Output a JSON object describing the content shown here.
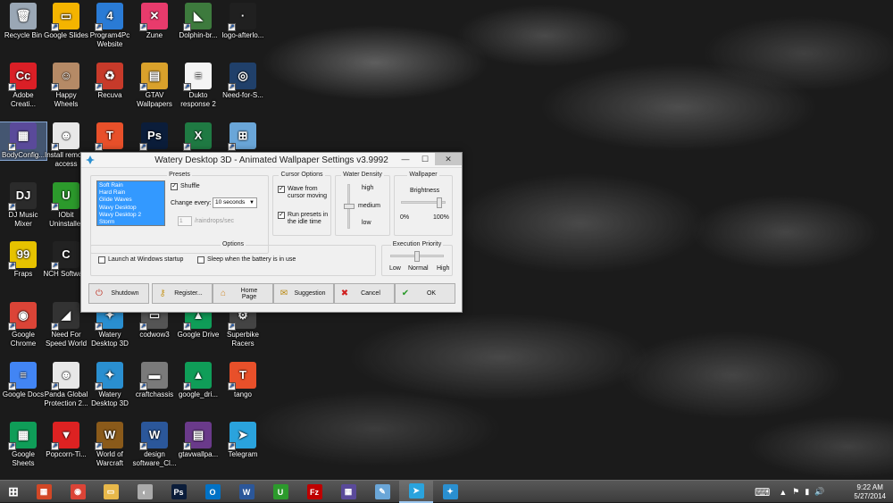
{
  "desktop_icons": [
    {
      "id": "recycle-bin",
      "label": "Recycle Bin",
      "color": "#9aa7b5",
      "glyph": "🗑"
    },
    {
      "id": "google-slides",
      "label": "Google Slides",
      "color": "#f4b400",
      "glyph": "▭"
    },
    {
      "id": "program4pc",
      "label": "Program4Pc Website",
      "color": "#2a7bd5",
      "glyph": "4"
    },
    {
      "id": "zune",
      "label": "Zune",
      "color": "#e83b6c",
      "glyph": "✕"
    },
    {
      "id": "dolphin",
      "label": "Dolphin-br...",
      "color": "#3d7a3d",
      "glyph": "◣"
    },
    {
      "id": "logo-afterlo",
      "label": "logo-afterlo...",
      "color": "#202020",
      "glyph": "·"
    },
    {
      "id": "adobe-creative",
      "label": "Adobe Creati...",
      "color": "#da1f26",
      "glyph": "Cc"
    },
    {
      "id": "happy-wheels",
      "label": "Happy Wheels",
      "color": "#b58a66",
      "glyph": "☺"
    },
    {
      "id": "recuva",
      "label": "Recuva",
      "color": "#c73a2a",
      "glyph": "♻"
    },
    {
      "id": "gtav-wallpapers",
      "label": "GTAV Wallpapers",
      "color": "#d9a12b",
      "glyph": "▤"
    },
    {
      "id": "dukto",
      "label": "Dukto response 2",
      "color": "#f4f4f4",
      "glyph": "≡"
    },
    {
      "id": "need-for-speed-1",
      "label": "Need-for-S...",
      "color": "#20406a",
      "glyph": "◎"
    },
    {
      "id": "bodyconfig",
      "label": "BodyConfig...",
      "color": "#5a4a9a",
      "glyph": "▦"
    },
    {
      "id": "install-remove",
      "label": "Install remo... access",
      "color": "#e8e8e8",
      "glyph": "☻"
    },
    {
      "id": "typora",
      "label": "",
      "color": "#e8502a",
      "glyph": "T"
    },
    {
      "id": "photoshop",
      "label": "",
      "color": "#0b1d3a",
      "glyph": "Ps"
    },
    {
      "id": "excel",
      "label": "",
      "color": "#1f7a43",
      "glyph": "X"
    },
    {
      "id": "windows-tile",
      "label": "",
      "color": "#6aa6d8",
      "glyph": "⊞"
    },
    {
      "id": "dj-music-mixer",
      "label": "DJ Music Mixer",
      "color": "#2b2b2b",
      "glyph": "DJ"
    },
    {
      "id": "iobit",
      "label": "IObit Uninstaller",
      "color": "#2c9a2c",
      "glyph": "U"
    },
    {
      "id": "fraps",
      "label": "Fraps",
      "color": "#e6c200",
      "glyph": "99"
    },
    {
      "id": "nch",
      "label": "NCH Software",
      "color": "#222",
      "glyph": "C"
    },
    {
      "id": "google-chrome",
      "label": "Google Chrome",
      "color": "#db4437",
      "glyph": "◉"
    },
    {
      "id": "nfs-world",
      "label": "Need For Speed World",
      "color": "#333",
      "glyph": "◢"
    },
    {
      "id": "watery-1",
      "label": "Watery Desktop 3D",
      "color": "#2a8fd0",
      "glyph": "✦"
    },
    {
      "id": "codwow3",
      "label": "codwow3",
      "color": "#555",
      "glyph": "▭"
    },
    {
      "id": "google-drive-1",
      "label": "Google Drive",
      "color": "#0f9d58",
      "glyph": "▲"
    },
    {
      "id": "superbike",
      "label": "Superbike Racers",
      "color": "#444",
      "glyph": "⚙"
    },
    {
      "id": "google-docs",
      "label": "Google Docs",
      "color": "#4285f4",
      "glyph": "≡"
    },
    {
      "id": "panda",
      "label": "Panda Global Protection 2...",
      "color": "#e8e8e8",
      "glyph": "☻"
    },
    {
      "id": "watery-2",
      "label": "Watery Desktop 3D",
      "color": "#2a8fd0",
      "glyph": "✦"
    },
    {
      "id": "craftchassis",
      "label": "craftchassis",
      "color": "#7a7a7a",
      "glyph": "▬"
    },
    {
      "id": "google-drive-2",
      "label": "google_dri...",
      "color": "#0f9d58",
      "glyph": "▲"
    },
    {
      "id": "tango",
      "label": "tango",
      "color": "#e8502a",
      "glyph": "T"
    },
    {
      "id": "google-sheets",
      "label": "Google Sheets",
      "color": "#0f9d58",
      "glyph": "▦"
    },
    {
      "id": "popcorn",
      "label": "Popcorn-Ti...",
      "color": "#d22",
      "glyph": "▼"
    },
    {
      "id": "wow",
      "label": "World of Warcraft",
      "color": "#8a5a1a",
      "glyph": "W"
    },
    {
      "id": "design-software",
      "label": "design software_Cl...",
      "color": "#2b579a",
      "glyph": "W"
    },
    {
      "id": "gtavwallpa",
      "label": "gtavwallpa...",
      "color": "#6a3a8a",
      "glyph": "▤"
    },
    {
      "id": "telegram",
      "label": "Telegram",
      "color": "#2aa3dd",
      "glyph": "➤"
    }
  ],
  "dialog": {
    "title": "Watery Desktop 3D - Animated Wallpaper Settings  v3.9992",
    "presets": {
      "title": "Presets",
      "items": [
        "Soft Rain",
        "Hard Rain",
        "Glide Waves",
        "Wavy Desktop",
        "Wavy Desktop 2",
        "Storm"
      ],
      "shuffle_label": "Shuffle",
      "shuffle_checked": true,
      "change_every_label": "Change every:",
      "change_every_value": "10 seconds",
      "raindrops_value": "1",
      "raindrops_label": "/raindrops/sec"
    },
    "cursor_options": {
      "title": "Cursor Options",
      "wave_label": "Wave from cursor moving",
      "wave_checked": true,
      "run_presets_label": "Run presets in the idle time",
      "run_presets_checked": true
    },
    "water_density": {
      "title": "Water Density",
      "high": "high",
      "medium": "medium",
      "low": "low",
      "level": 0.5
    },
    "wallpaper": {
      "title": "Wallpaper",
      "brightness_label": "Brightness",
      "min": "0%",
      "max": "100%",
      "level": 0.9
    },
    "options": {
      "title": "Options",
      "launch_label": "Launch at Windows startup",
      "launch_checked": false,
      "sleep_label": "Sleep when the battery is in use",
      "sleep_checked": false
    },
    "execution_priority": {
      "title": "Execution Priority",
      "low": "Low",
      "normal": "Normal",
      "high": "High",
      "level": 0.5
    },
    "buttons": {
      "shutdown": "Shutdown",
      "register": "Register...",
      "home_page": "Home Page",
      "suggestion": "Suggestion",
      "cancel": "Cancel",
      "ok": "OK"
    }
  },
  "taskbar": {
    "items": [
      {
        "id": "start",
        "color": "transparent",
        "glyph": "⊞"
      },
      {
        "id": "apps",
        "color": "#d24726",
        "glyph": "▦"
      },
      {
        "id": "chrome",
        "color": "#db4437",
        "glyph": "◉"
      },
      {
        "id": "explorer",
        "color": "#e8b84a",
        "glyph": "▭"
      },
      {
        "id": "paint-app",
        "color": "#aaa",
        "glyph": "◐"
      },
      {
        "id": "photoshop",
        "color": "#0b1d3a",
        "glyph": "Ps"
      },
      {
        "id": "outlook",
        "color": "#0072c6",
        "glyph": "O"
      },
      {
        "id": "word",
        "color": "#2b579a",
        "glyph": "W"
      },
      {
        "id": "iobit",
        "color": "#2c9a2c",
        "glyph": "U"
      },
      {
        "id": "filezilla",
        "color": "#bf0000",
        "glyph": "Fz"
      },
      {
        "id": "bodyconfig",
        "color": "#5a4a9a",
        "glyph": "▦"
      },
      {
        "id": "paint",
        "color": "#6aa6d8",
        "glyph": "✎"
      },
      {
        "id": "telegram",
        "color": "#2aa3dd",
        "glyph": "➤"
      },
      {
        "id": "watery",
        "color": "#2a8fd0",
        "glyph": "✦"
      }
    ],
    "active_index": 12,
    "time": "9:22 AM",
    "date": "5/27/2014"
  }
}
